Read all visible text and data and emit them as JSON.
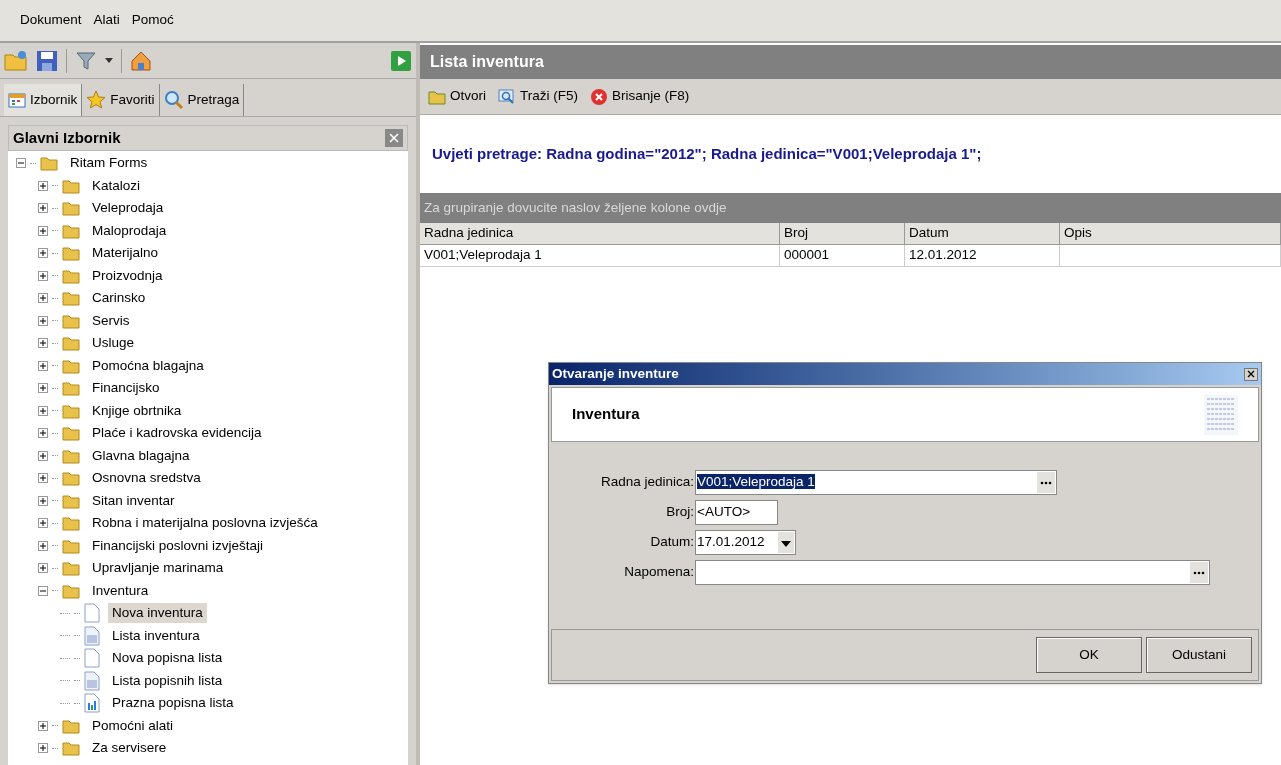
{
  "menu": [
    "Dokument",
    "Alati",
    "Pomoć"
  ],
  "left_tabs": [
    {
      "label": "Izbornik",
      "selected": true
    },
    {
      "label": "Favoriti",
      "selected": false
    },
    {
      "label": "Pretraga",
      "selected": false
    }
  ],
  "panel": {
    "title": "Glavni Izbornik"
  },
  "tree": [
    {
      "label": "Ritam Forms",
      "kind": "folder",
      "expanded": true,
      "selected": false,
      "children": [
        {
          "label": "Katalozi",
          "kind": "folder",
          "expanded": false,
          "selected": false
        },
        {
          "label": "Veleprodaja",
          "kind": "folder",
          "expanded": false,
          "selected": false
        },
        {
          "label": "Maloprodaja",
          "kind": "folder",
          "expanded": false,
          "selected": false
        },
        {
          "label": "Materijalno",
          "kind": "folder",
          "expanded": false,
          "selected": false
        },
        {
          "label": "Proizvodnja",
          "kind": "folder",
          "expanded": false,
          "selected": false
        },
        {
          "label": "Carinsko",
          "kind": "folder",
          "expanded": false,
          "selected": false
        },
        {
          "label": "Servis",
          "kind": "folder",
          "expanded": false,
          "selected": false
        },
        {
          "label": "Usluge",
          "kind": "folder",
          "expanded": false,
          "selected": false
        },
        {
          "label": "Pomoćna blagajna",
          "kind": "folder",
          "expanded": false,
          "selected": false
        },
        {
          "label": "Financijsko",
          "kind": "folder",
          "expanded": false,
          "selected": false
        },
        {
          "label": "Knjige obrtnika",
          "kind": "folder",
          "expanded": false,
          "selected": false
        },
        {
          "label": "Plaće i kadrovska evidencija",
          "kind": "folder",
          "expanded": false,
          "selected": false
        },
        {
          "label": "Glavna blagajna",
          "kind": "folder",
          "expanded": false,
          "selected": false
        },
        {
          "label": "Osnovna sredstva",
          "kind": "folder",
          "expanded": false,
          "selected": false
        },
        {
          "label": "Sitan inventar",
          "kind": "folder",
          "expanded": false,
          "selected": false
        },
        {
          "label": "Robna i materijalna poslovna izvješća",
          "kind": "folder",
          "expanded": false,
          "selected": false
        },
        {
          "label": "Financijski poslovni izvještaji",
          "kind": "folder",
          "expanded": false,
          "selected": false
        },
        {
          "label": "Upravljanje marinama",
          "kind": "folder",
          "expanded": false,
          "selected": false
        },
        {
          "label": "Inventura",
          "kind": "folder",
          "expanded": true,
          "selected": false,
          "children": [
            {
              "label": "Nova inventura",
              "kind": "page",
              "selected": true
            },
            {
              "label": "Lista inventura",
              "kind": "list",
              "selected": false
            },
            {
              "label": "Nova popisna lista",
              "kind": "page",
              "selected": false
            },
            {
              "label": "Lista popisnih lista",
              "kind": "list",
              "selected": false
            },
            {
              "label": "Prazna popisna lista",
              "kind": "chart",
              "selected": false
            }
          ]
        },
        {
          "label": "Pomoćni alati",
          "kind": "folder",
          "expanded": false,
          "selected": false
        },
        {
          "label": "Za servisere",
          "kind": "folder",
          "expanded": false,
          "selected": false
        }
      ]
    }
  ],
  "content": {
    "title": "Lista inventura",
    "toolbar": [
      {
        "label": "Otvori"
      },
      {
        "label": "Traži (F5)"
      },
      {
        "label": "Brisanje (F8)"
      }
    ],
    "filter": "Uvjeti pretrage: Radna godina=\"2012\"; Radna jedinica=\"V001;Veleprodaja 1\";",
    "group_hint": "Za grupiranje dovucite naslov željene kolone ovdje",
    "table": {
      "columns": [
        "Radna jedinica",
        "Broj",
        "Datum",
        "Opis"
      ],
      "rows": [
        [
          "V001;Veleprodaja 1",
          "000001",
          "12.01.2012",
          ""
        ]
      ]
    }
  },
  "dialog": {
    "title": "Otvaranje inventure",
    "heading": "Inventura",
    "fields": [
      {
        "label": "Radna jedinica:",
        "value": "V001;Veleprodaja 1",
        "kind": "lookup",
        "highlighted": true
      },
      {
        "label": "Broj:",
        "value": "<AUTO>",
        "kind": "text",
        "highlighted": false
      },
      {
        "label": "Datum:",
        "value": "17.01.2012",
        "kind": "date",
        "highlighted": false
      },
      {
        "label": "Napomena:",
        "kind": "memo"
      }
    ],
    "buttons": [
      "OK",
      "Odustani"
    ]
  }
}
